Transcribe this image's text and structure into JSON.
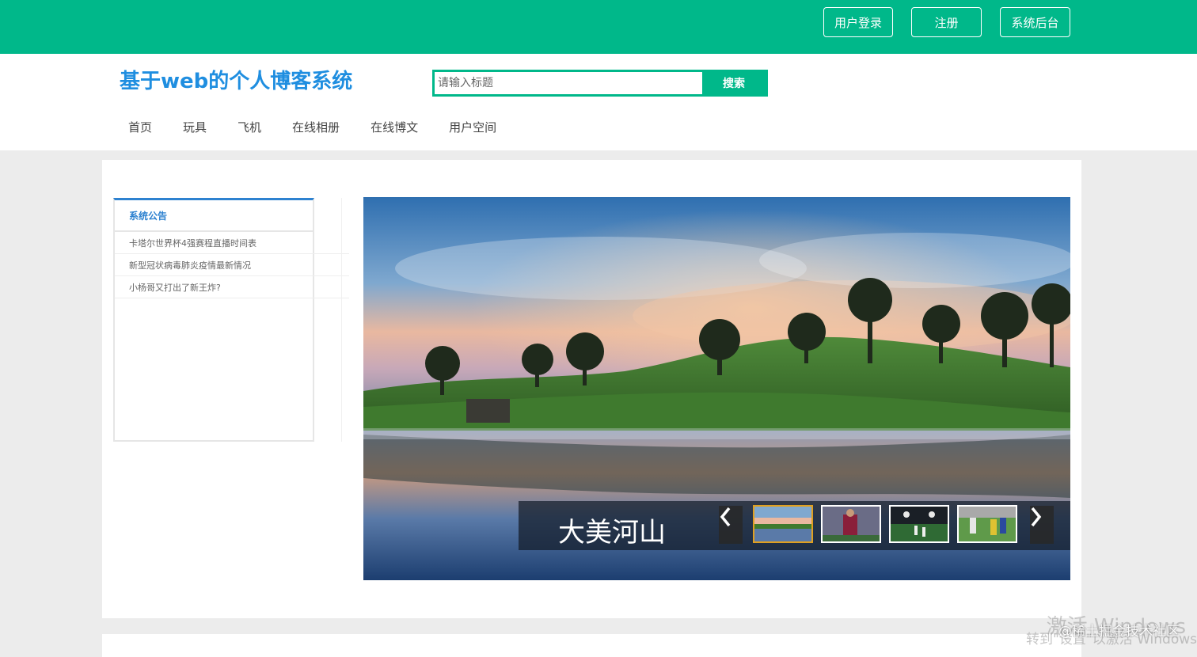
{
  "topbar": {
    "login_label": "用户登录",
    "register_label": "注册",
    "admin_label": "系统后台",
    "color": "#00b88a"
  },
  "header": {
    "site_title": "基于web的个人博客系统",
    "search_placeholder": "请输入标题",
    "search_button": "搜索"
  },
  "nav": {
    "items": [
      "首页",
      "玩具",
      "飞机",
      "在线相册",
      "在线博文",
      "用户空间"
    ]
  },
  "notice": {
    "title": "系统公告",
    "items": [
      "卡塔尔世界杯4强赛程直播时间表",
      "新型冠状病毒肺炎疫情最新情况",
      "小杨哥又打出了新王炸?"
    ]
  },
  "slider": {
    "caption": "大美河山",
    "prev_icon": "chevron-left-icon",
    "next_icon": "chevron-right-icon",
    "thumbs": [
      "thumb-landscape",
      "thumb-soccer-player",
      "thumb-stadium",
      "thumb-soccer-match"
    ]
  },
  "overlay": {
    "watermark_line1": "激活 Windows",
    "watermark_line2": "转到\"设置\"以激活 Windows",
    "credit": "@稀土掘金技术社区"
  }
}
